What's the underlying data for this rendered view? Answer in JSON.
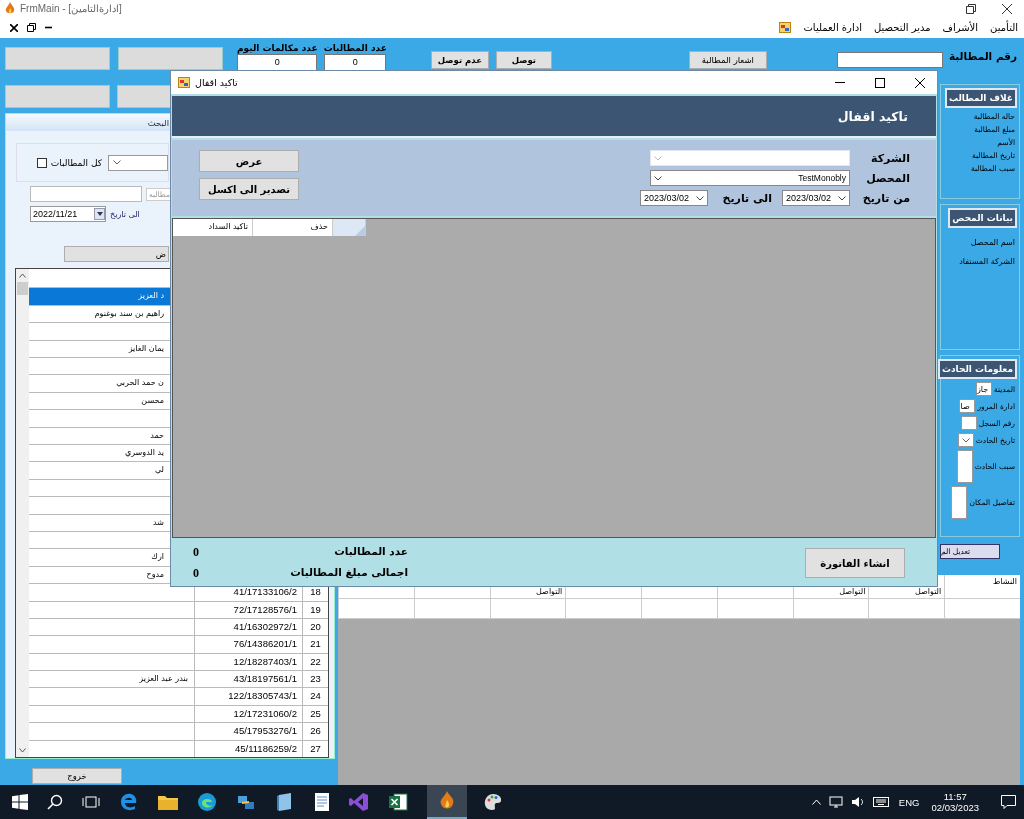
{
  "window": {
    "title": "FrmMain - [ادارةالتامين]"
  },
  "menu": {
    "items": [
      "التأمين",
      "الأشراف",
      "مدير التحصيل",
      "ادارة العمليات"
    ]
  },
  "top_bar": {
    "calls_today": {
      "label": "عدد مكالمات اليوم",
      "value": "0"
    },
    "claims_count": {
      "label": "عدد المطالبات",
      "value": "0"
    },
    "buttons": [
      "توصل",
      "عدم توصل"
    ],
    "notify_button": "اشعار المطالبة",
    "claim_number": {
      "label": "رقم المطالبة"
    }
  },
  "search_panel": {
    "header": "البحث",
    "all_claims": {
      "label": "كل المطالبات",
      "checked": false
    },
    "claim_label": "مطالبه",
    "to_date": {
      "label": "الى تاريخ",
      "value": "2022/11/21"
    },
    "button": "ض"
  },
  "claims_list": {
    "rows": [
      {
        "name": "د العزيز",
        "selected": true
      },
      {
        "name": "راهيم بن سند بوغنوم",
        "selected": false
      },
      {
        "selected": false
      },
      {
        "name": "يمان الغايز",
        "selected": false
      },
      {
        "selected": false
      },
      {
        "name": "ن حمد الحربي",
        "selected": false
      },
      {
        "name": "محسن",
        "selected": false
      },
      {
        "selected": false
      },
      {
        "name": "حمد",
        "selected": false
      },
      {
        "name": "يد الدوسري",
        "selected": false
      },
      {
        "name": "لي",
        "selected": false
      },
      {
        "selected": false
      },
      {
        "selected": false
      },
      {
        "name": "شد",
        "selected": false
      },
      {
        "selected": false
      },
      {
        "name": "ارك",
        "selected": false
      },
      {
        "name": "مدوح",
        "selected": false
      },
      {
        "number": "41/17133106/2",
        "index": "18",
        "selected": false
      },
      {
        "number": "72/17128576/1",
        "index": "19",
        "selected": false
      },
      {
        "number": "41/16302972/1",
        "index": "20",
        "selected": false
      },
      {
        "number": "76/14386201/1",
        "index": "21",
        "selected": false
      },
      {
        "number": "12/18287403/1",
        "index": "22",
        "selected": false
      },
      {
        "name": "بندر عبد العزيز",
        "number": "43/18197561/1",
        "index": "23",
        "selected": false
      },
      {
        "number": "122/18305743/1",
        "index": "24",
        "selected": false
      },
      {
        "number": "12/17231060/2",
        "index": "25",
        "selected": false
      },
      {
        "number": "45/17953276/1",
        "index": "26",
        "selected": false
      },
      {
        "number": "45/11186259/2",
        "index": "27",
        "selected": false
      }
    ]
  },
  "exit_button": "خروج",
  "right_panel": {
    "claim_cover": {
      "title": "غلاف المطالب",
      "labels": [
        "حاله المطالبة",
        "مبلغ المطالبة",
        "الأسم",
        "تاريخ المطالبة",
        "سبب المطالبة"
      ]
    },
    "collector": {
      "title": "بيانات المحص",
      "labels": [
        "اسم المحصل",
        "الشركة المستفاد"
      ]
    },
    "accident": {
      "title": "معلومات الحادث",
      "fields": [
        {
          "label": "المدينة",
          "kind": "text",
          "value": "جاز"
        },
        {
          "label": "ادارة المرور",
          "kind": "text",
          "value": "صا"
        },
        {
          "label": "رقم السجل",
          "kind": "text"
        },
        {
          "label": "تاريخ الحادث",
          "kind": "dropdown"
        },
        {
          "label": "سبب الحادث",
          "kind": "memo"
        },
        {
          "label": "تفاصيل المكان",
          "kind": "memo"
        }
      ]
    },
    "edit_button": "تعديل الم"
  },
  "activity_table": {
    "columns": [
      {
        "label": "النشاط"
      },
      {
        "label": "التواصل"
      },
      {
        "label": "التواصل"
      },
      {},
      {},
      {},
      {
        "label": "التواصل"
      },
      {},
      {}
    ]
  },
  "dialog": {
    "title": "تاكيد اقفال",
    "heading": "تاكيد اقفال",
    "company": {
      "label": "الشركة"
    },
    "collector": {
      "label": "المحصل",
      "value": "TestMonobly"
    },
    "from_date": {
      "label": "من تاريخ",
      "value": "2023/03/02"
    },
    "to_date": {
      "label": "الى تاريخ",
      "value": "2023/03/02"
    },
    "buttons": [
      "عرض",
      "تصدير الى اكسل"
    ],
    "grid_columns": [
      "حذف",
      "تاكيد السداد"
    ],
    "footer": {
      "count_label": "عدد المطالبات",
      "count": "0",
      "total_label": "اجمالى مبلغ المطالبات",
      "total": "0",
      "button": "انشاء الفاتورة"
    }
  },
  "taskbar": {
    "language": "ENG",
    "time": "11:57",
    "date": "02/03/2023"
  }
}
